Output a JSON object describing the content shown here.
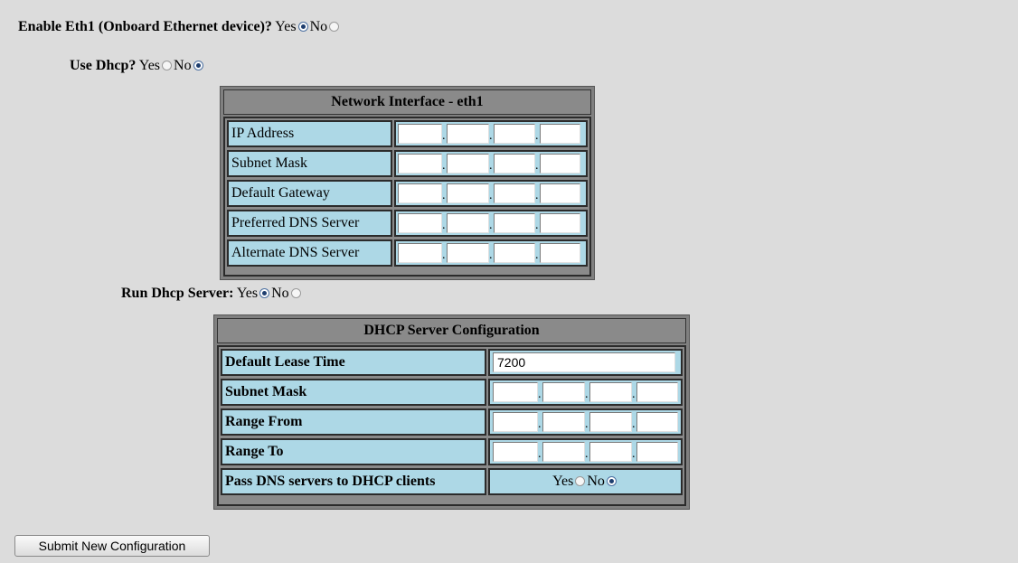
{
  "enable_eth1": {
    "label": "Enable Eth1 (Onboard Ethernet device)?",
    "yes": "Yes",
    "no": "No",
    "selected": "yes"
  },
  "use_dhcp": {
    "label": "Use Dhcp?",
    "yes": "Yes",
    "no": "No",
    "selected": "no"
  },
  "network_interface": {
    "title": "Network Interface - eth1",
    "rows": [
      {
        "label": "IP Address",
        "octets": [
          "",
          "",
          "",
          ""
        ]
      },
      {
        "label": "Subnet Mask",
        "octets": [
          "",
          "",
          "",
          ""
        ]
      },
      {
        "label": "Default Gateway",
        "octets": [
          "",
          "",
          "",
          ""
        ]
      },
      {
        "label": "Preferred DNS Server",
        "octets": [
          "",
          "",
          "",
          ""
        ]
      },
      {
        "label": "Alternate DNS Server",
        "octets": [
          "",
          "",
          "",
          ""
        ]
      }
    ],
    "separator": "."
  },
  "run_dhcp_server": {
    "label": "Run Dhcp Server:",
    "yes": "Yes",
    "no": "No",
    "selected": "yes"
  },
  "dhcp_config": {
    "title": "DHCP Server Configuration",
    "lease_label": "Default Lease Time",
    "lease_value": "7200",
    "rows": [
      {
        "label": "Subnet Mask",
        "octets": [
          "",
          "",
          "",
          ""
        ]
      },
      {
        "label": "Range From",
        "octets": [
          "",
          "",
          "",
          ""
        ]
      },
      {
        "label": "Range To",
        "octets": [
          "",
          "",
          "",
          ""
        ]
      }
    ],
    "pass_dns": {
      "label": "Pass DNS servers to DHCP clients",
      "yes": "Yes",
      "no": "No",
      "selected": "no"
    }
  },
  "submit_label": "Submit New Configuration"
}
